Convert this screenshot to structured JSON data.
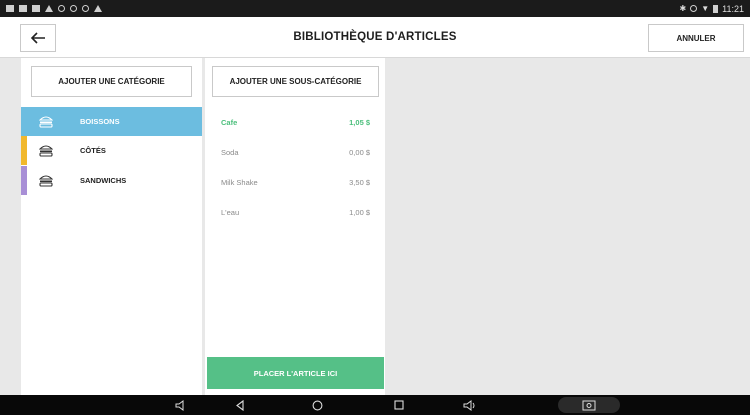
{
  "status_bar": {
    "time": "11:21"
  },
  "header": {
    "title": "BIBLIOTHÈQUE D'ARTICLES",
    "back_icon": "arrow-left-icon",
    "cancel_label": "ANNULER"
  },
  "categories": {
    "add_label": "AJOUTER UNE CATÉGORIE",
    "items": [
      {
        "label": "BOISSONS",
        "color": "#6cbde0",
        "icon": "burger-icon",
        "active": true
      },
      {
        "label": "CÔTÉS",
        "color": "#f1b82d",
        "icon": "burger-icon",
        "active": false
      },
      {
        "label": "SANDWICHS",
        "color": "#a88fd6",
        "icon": "burger-icon",
        "active": false
      }
    ]
  },
  "subcategories": {
    "add_label": "AJOUTER UNE SOUS-CATÉGORIE",
    "articles": [
      {
        "name": "Cafe",
        "price": "1,05 $",
        "selected": true
      },
      {
        "name": "Soda",
        "price": "0,00 $",
        "selected": false
      },
      {
        "name": "Milk Shake",
        "price": "3,50 $",
        "selected": false
      },
      {
        "name": "L'eau",
        "price": "1,00 $",
        "selected": false
      }
    ]
  },
  "place_button_label": "PLACER L'ARTICLE ICI",
  "colors": {
    "accent_blue": "#6cbde0",
    "accent_green": "#55c087",
    "selected_text": "#4cbf7c"
  },
  "nav_bar": {
    "items": [
      "volume-down-icon",
      "back-triangle-icon",
      "home-circle-icon",
      "recents-square-icon",
      "volume-up-icon",
      "screenshot-icon"
    ]
  }
}
